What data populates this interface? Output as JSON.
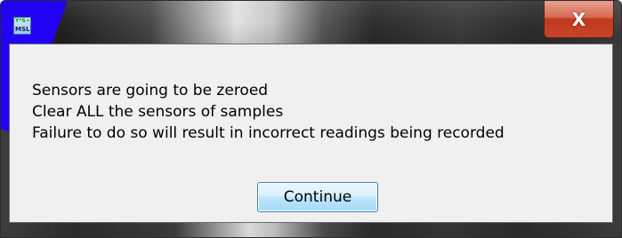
{
  "window": {
    "close_label": "X",
    "icon_text_top": "Y*S+",
    "icon_text_bottom": "MSL"
  },
  "dialog": {
    "lines": [
      "Sensors are going to be zeroed",
      "Clear ALL the sensors of samples",
      "Failure to do so will result in incorrect readings being recorded"
    ],
    "button_label": "Continue"
  },
  "colors": {
    "accent": "#2200ff",
    "close": "#c6442a",
    "button_border": "#3c7fb1",
    "dialog_bg": "#f0f0f0"
  }
}
